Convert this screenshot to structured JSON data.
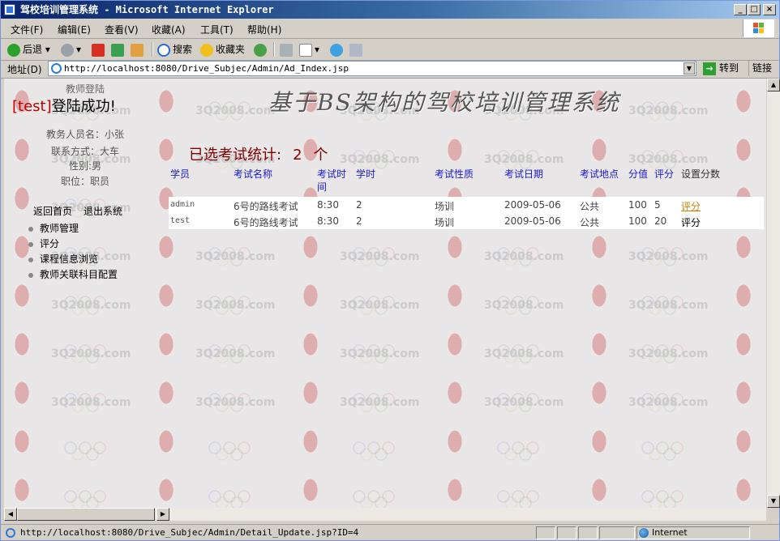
{
  "window": {
    "title": "驾校培训管理系统 - Microsoft Internet Explorer",
    "controls": {
      "minimize": "_",
      "maximize": "□",
      "close": "×"
    }
  },
  "menubar": [
    "文件(F)",
    "编辑(E)",
    "查看(V)",
    "收藏(A)",
    "工具(T)",
    "帮助(H)"
  ],
  "toolbar": {
    "back": "后退",
    "search": "搜索",
    "favorites": "收藏夹"
  },
  "address": {
    "label": "地址(D)",
    "url": "http://localhost:8080/Drive_Subjec/Admin/Ad_Index.jsp",
    "go": "转到",
    "links": "链接"
  },
  "watermark": "3Q2008.com",
  "left": {
    "role_title": "教师登陆",
    "login_user": "[test]",
    "login_msg": "登陆成功!",
    "info": [
      "教务人员名：小张",
      "联系方式：大车",
      "性别:男",
      "职位：职员"
    ],
    "home_link": "返回首页",
    "logout_link": "退出系统",
    "menu": [
      "教师管理",
      "评分",
      "课程信息浏览",
      "教师关联科目配置"
    ]
  },
  "banner": "基于BS架构的驾校培训管理系统",
  "stat": {
    "label": "已选考试统计:",
    "count": "2",
    "unit": "个"
  },
  "table": {
    "headers": [
      "学员",
      "考试名称",
      "考试时间",
      "学时",
      "考试性质",
      "考试日期",
      "考试地点",
      "分值",
      "评分",
      "设置分数"
    ],
    "rows": [
      {
        "student": "admin",
        "exam": "6号的路线考试",
        "time": "8:30",
        "hours": "2",
        "nature": "场训",
        "date": "2009-05-06",
        "place": "公共",
        "value": "100",
        "score": "5",
        "action": "评分"
      },
      {
        "student": "test",
        "exam": "6号的路线考试",
        "time": "8:30",
        "hours": "2",
        "nature": "场训",
        "date": "2009-05-06",
        "place": "公共",
        "value": "100",
        "score": "20",
        "action": "评分"
      }
    ]
  },
  "status": {
    "url": "http://localhost:8080/Drive_Subjec/Admin/Detail_Update.jsp?ID=4",
    "zone": "Internet"
  }
}
